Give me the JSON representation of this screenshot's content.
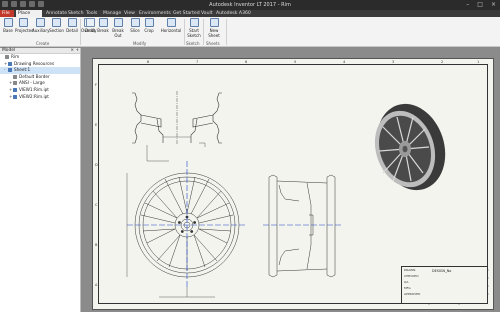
{
  "window": {
    "title": "Autodesk Inventor LT 2017 - Rim"
  },
  "tabs": [
    {
      "id": "file",
      "label": "File"
    },
    {
      "id": "place_views",
      "label": "Place Views"
    },
    {
      "id": "annotate",
      "label": "Annotate"
    },
    {
      "id": "sketch",
      "label": "Sketch"
    },
    {
      "id": "tools",
      "label": "Tools"
    },
    {
      "id": "manage",
      "label": "Manage"
    },
    {
      "id": "view",
      "label": "View"
    },
    {
      "id": "environments",
      "label": "Environments"
    },
    {
      "id": "get_started",
      "label": "Get Started"
    },
    {
      "id": "vault",
      "label": "Vault"
    },
    {
      "id": "autodesk_a360",
      "label": "Autodesk A360"
    }
  ],
  "ribbon": {
    "create": {
      "label": "Create",
      "buttons": [
        "Base",
        "Projected",
        "Auxiliary",
        "Section",
        "Detail"
      ]
    },
    "modify": {
      "label": "Modify",
      "buttons": [
        "Overlay",
        "Draft",
        "Break",
        "Break Out",
        "Slice",
        "Crop",
        "Horizontal"
      ]
    },
    "sketch": {
      "label": "Sketch",
      "buttons": [
        "Start Sketch"
      ]
    },
    "sheets": {
      "label": "Sheets",
      "buttons": [
        "New Sheet"
      ]
    }
  },
  "browser": {
    "header": "Model",
    "items": [
      {
        "label": "Rim",
        "level": 0,
        "toggle": ""
      },
      {
        "label": "Drawing Resources",
        "level": 1,
        "toggle": "+"
      },
      {
        "label": "Sheet:1",
        "level": 1,
        "toggle": "-"
      },
      {
        "label": "Default Border",
        "level": 2,
        "toggle": ""
      },
      {
        "label": "ANSI - Large",
        "level": 2,
        "toggle": "+"
      },
      {
        "label": "VIEW1:Rim.ipt",
        "level": 2,
        "toggle": "+"
      },
      {
        "label": "VIEW2:Rim.ipt",
        "level": 2,
        "toggle": "+"
      }
    ]
  },
  "drawing": {
    "titleblock": {
      "name": "DESIGN_No",
      "rows": [
        "DRAWN",
        "CHECKED",
        "QA",
        "MFG",
        "APPROVED"
      ]
    },
    "zones_top": [
      "8",
      "7",
      "6",
      "5",
      "4",
      "3",
      "2",
      "1"
    ],
    "zones_left": [
      "F",
      "E",
      "D",
      "C",
      "B",
      "A"
    ]
  }
}
